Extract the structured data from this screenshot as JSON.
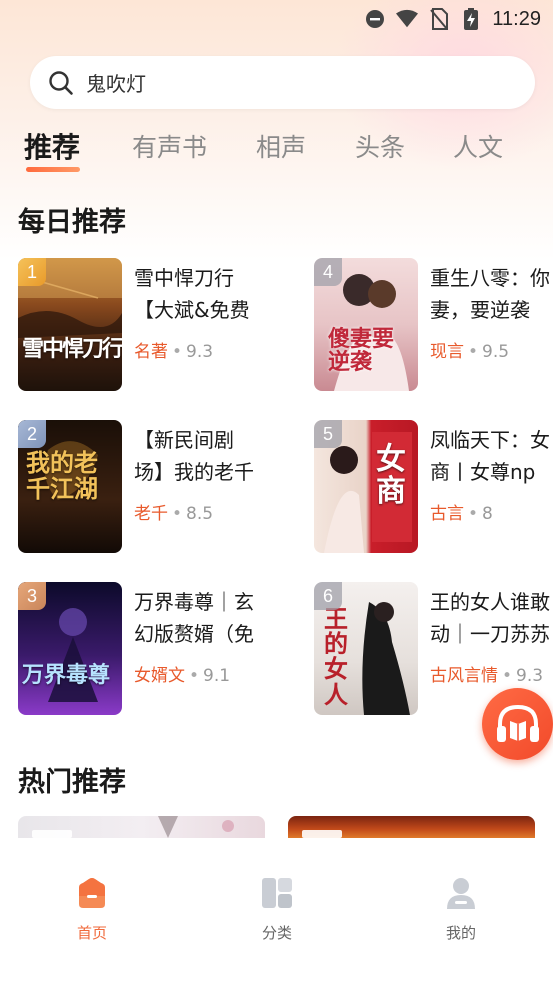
{
  "status": {
    "time": "11:29"
  },
  "search": {
    "text": "鬼吹灯"
  },
  "tabs": [
    "推荐",
    "有声书",
    "相声",
    "头条",
    "人文"
  ],
  "sections": {
    "daily": "每日推荐",
    "hot": "热门推荐"
  },
  "books": [
    {
      "rank": "1",
      "line1": "雪中悍刀行",
      "line2": "【大斌&免费",
      "category": "名著",
      "score": "9.3",
      "cover_text": "雪中悍刀行"
    },
    {
      "rank": "2",
      "line1": "【新民间剧",
      "line2": "场】我的老千",
      "category": "老千",
      "score": "8.5",
      "cover_text": "我的老千江湖"
    },
    {
      "rank": "3",
      "line1": "万界毒尊｜玄",
      "line2": "幻版赘婿（免",
      "category": "女婿文",
      "score": "9.1",
      "cover_text": "万界毒尊"
    },
    {
      "rank": "4",
      "line1": "重生八零：你",
      "line2": "妻，要逆袭",
      "category": "现言",
      "score": "9.5",
      "cover_text": "傻妻要逆袭"
    },
    {
      "rank": "5",
      "line1": "凤临天下：女",
      "line2": "商丨女尊np",
      "category": "古言",
      "score": "8",
      "cover_text": "女商"
    },
    {
      "rank": "6",
      "line1": "王的女人谁敢",
      "line2": "动｜一刀苏苏",
      "category": "古风言情",
      "score": "9.3",
      "cover_text": "王的女人"
    }
  ],
  "nav": [
    {
      "label": "首页",
      "icon": "home-icon"
    },
    {
      "label": "分类",
      "icon": "category-icon"
    },
    {
      "label": "我的",
      "icon": "profile-icon"
    }
  ],
  "colors": {
    "accent": "#f06a3b",
    "category": "#e85a2c"
  }
}
